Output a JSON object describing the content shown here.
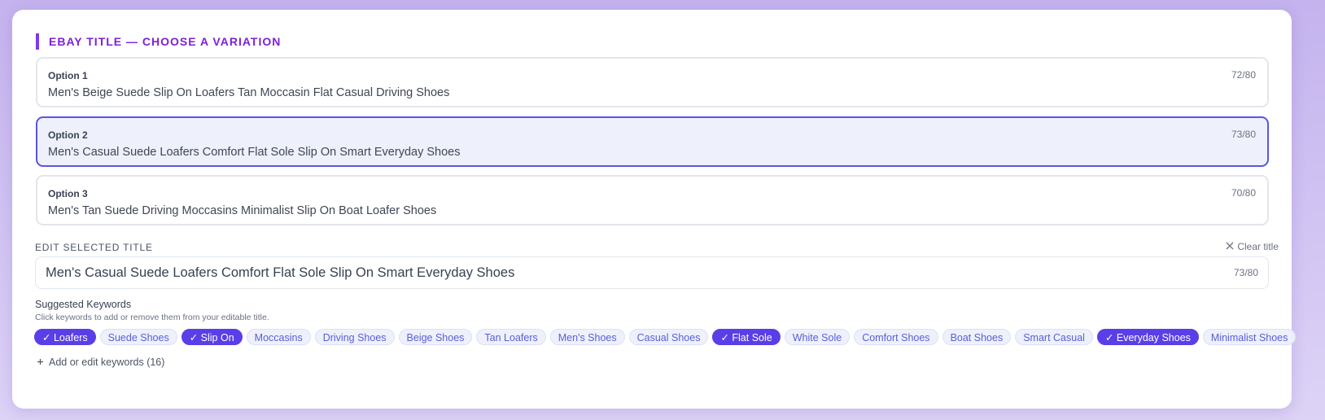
{
  "section": {
    "title": "EBAY TITLE — CHOOSE A VARIATION"
  },
  "options": [
    {
      "label": "Option 1",
      "text": "Men's Beige Suede Slip On Loafers Tan Moccasin Flat Casual Driving Shoes",
      "count": "72/80"
    },
    {
      "label": "Option 2",
      "text": "Men's Casual Suede Loafers Comfort Flat Sole Slip On Smart Everyday Shoes",
      "count": "73/80"
    },
    {
      "label": "Option 3",
      "text": "Men's Tan Suede Driving Moccasins Minimalist Slip On Boat Loafer Shoes",
      "count": "70/80"
    }
  ],
  "selected_option": 2,
  "edit": {
    "label": "EDIT SELECTED TITLE",
    "clear_label": "Clear title",
    "clear_icon": "close-icon",
    "value": "Men's Casual Suede Loafers Comfort Flat Sole Slip On Smart Everyday Shoes",
    "count": "73/80"
  },
  "keywords": {
    "heading": "Suggested Keywords",
    "subheading": "Click keywords to add or remove them from your editable title.",
    "chips": [
      {
        "label": "✓ Loafers",
        "active": true
      },
      {
        "label": "Suede Shoes",
        "active": false
      },
      {
        "label": "✓ Slip On",
        "active": true
      },
      {
        "label": "Moccasins",
        "active": false
      },
      {
        "label": "Driving Shoes",
        "active": false
      },
      {
        "label": "Beige Shoes",
        "active": false
      },
      {
        "label": "Tan Loafers",
        "active": false
      },
      {
        "label": "Men's Shoes",
        "active": false
      },
      {
        "label": "Casual Shoes",
        "active": false
      },
      {
        "label": "✓ Flat Sole",
        "active": true
      },
      {
        "label": "White Sole",
        "active": false
      },
      {
        "label": "Comfort Shoes",
        "active": false
      },
      {
        "label": "Boat Shoes",
        "active": false
      },
      {
        "label": "Smart Casual",
        "active": false
      },
      {
        "label": "✓ Everyday Shoes",
        "active": true
      },
      {
        "label": "Minimalist Shoes",
        "active": false
      }
    ],
    "add_icon": "plus-icon",
    "add_label": "Add or edit keywords (16)"
  },
  "colors": {
    "accent": "#7c3aed",
    "selected_border": "#5b55e0",
    "chip_active": "#5b3ee8"
  }
}
